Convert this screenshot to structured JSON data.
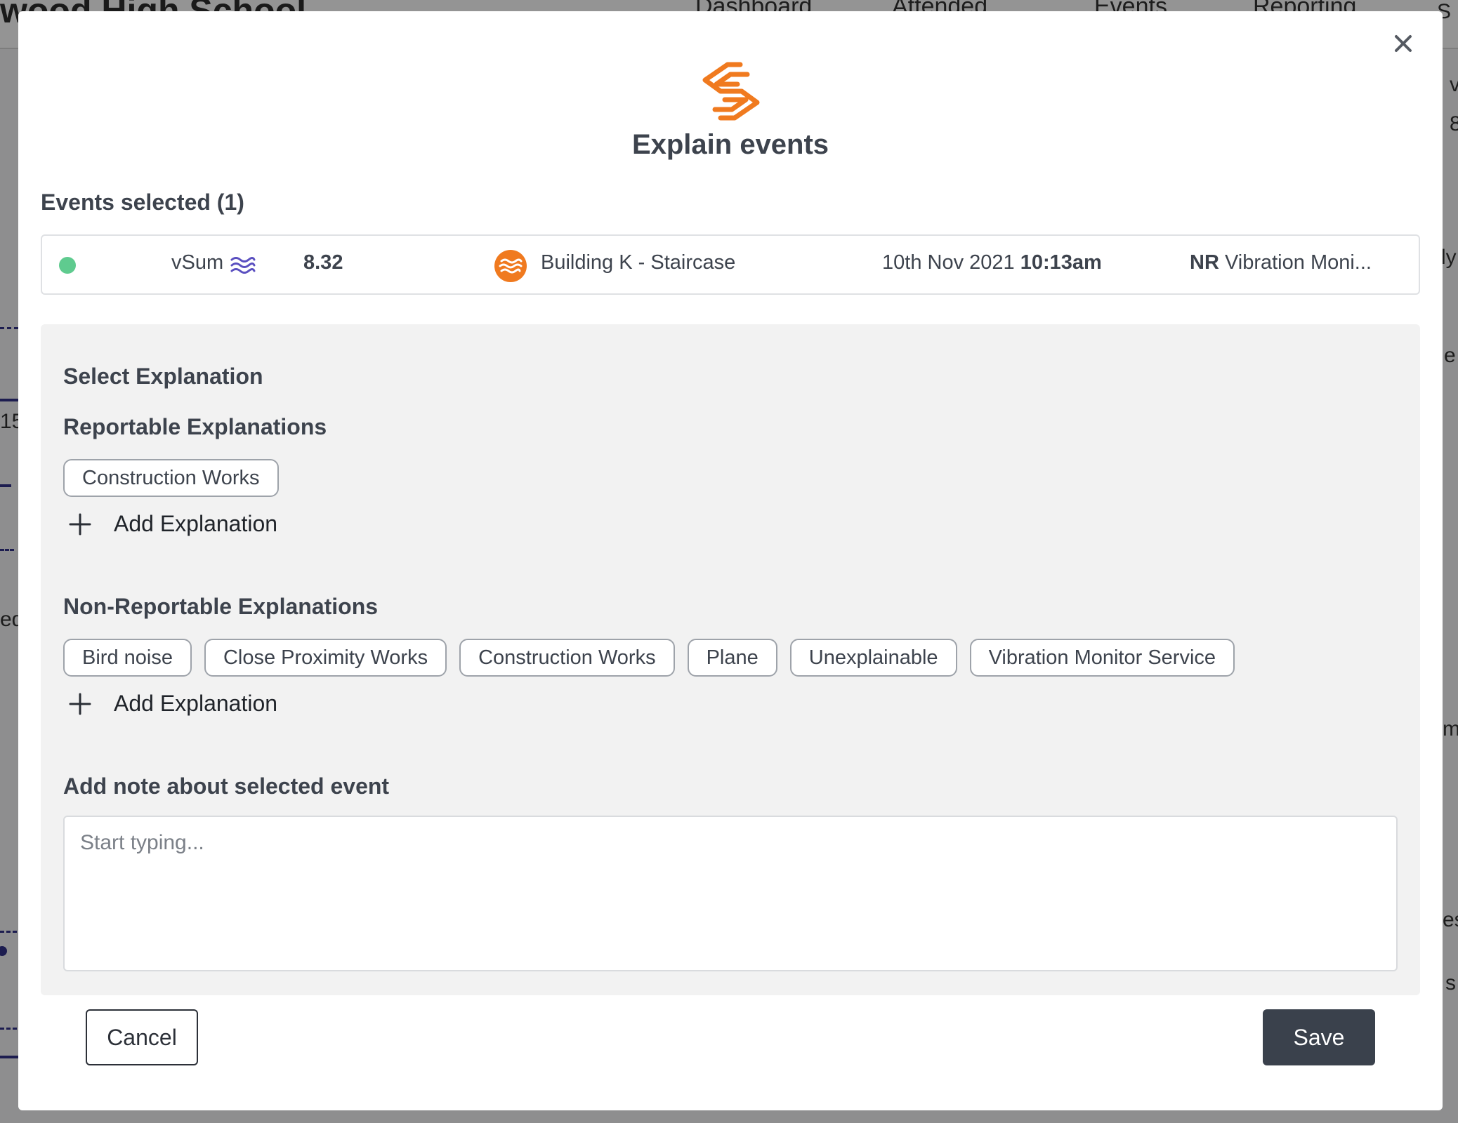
{
  "background": {
    "school_name": "wood High School",
    "nav": [
      "Dashboard",
      "Attended",
      "Events",
      "Reporting"
    ],
    "fragments": [
      "S",
      "v",
      "8",
      "ly",
      "e",
      "15",
      "eq",
      "m",
      "es",
      "s"
    ]
  },
  "modal": {
    "title": "Explain events",
    "events_selected_label": "Events selected (1)",
    "event": {
      "metric": "vSum",
      "value": "8.32",
      "location": "Building K - Staircase",
      "date": "10th Nov 2021",
      "time": "10:13am",
      "monitor_prefix": "NR",
      "monitor_name": "Vibration Moni..."
    },
    "select_explanation_title": "Select Explanation",
    "reportable": {
      "title": "Reportable Explanations",
      "chips": [
        "Construction Works"
      ],
      "add_label": "Add Explanation"
    },
    "non_reportable": {
      "title": "Non-Reportable Explanations",
      "chips": [
        "Bird noise",
        "Close Proximity Works",
        "Construction Works",
        "Plane",
        "Unexplainable",
        "Vibration Monitor Service"
      ],
      "add_label": "Add Explanation"
    },
    "note": {
      "label": "Add note about selected event",
      "value": "",
      "placeholder": "Start typing..."
    },
    "cancel_label": "Cancel",
    "save_label": "Save"
  },
  "colors": {
    "brand_orange": "#f07a1f",
    "status_green": "#5fcb8f",
    "wave_purple": "#5a4fc0",
    "primary_dark": "#3a414c"
  },
  "icons": {
    "close": "close-icon",
    "logo": "brand-logo-icon",
    "wave": "vibration-wave-icon",
    "location": "location-wave-icon",
    "add": "plus-icon"
  }
}
